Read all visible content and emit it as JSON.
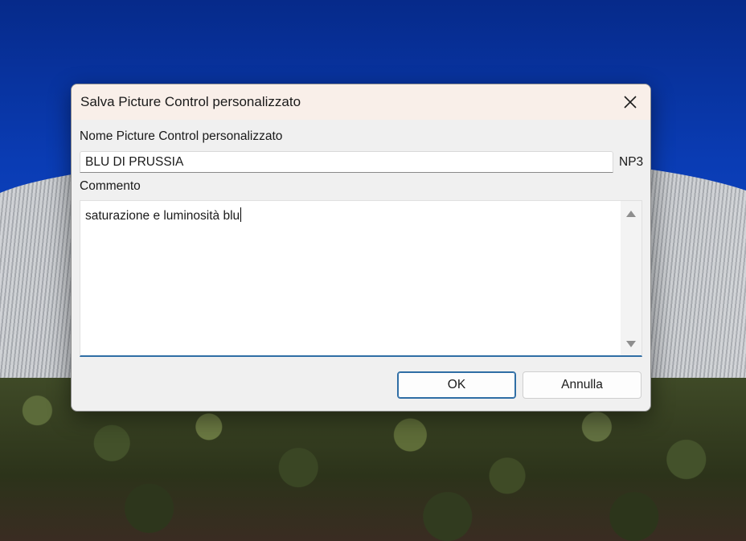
{
  "dialog": {
    "title": "Salva Picture Control personalizzato",
    "name_label": "Nome Picture Control personalizzato",
    "name_value": "BLU DI PRUSSIA",
    "extension": "NP3",
    "comment_label": "Commento",
    "comment_value": "saturazione e luminosità blu",
    "ok_label": "OK",
    "cancel_label": "Annulla"
  },
  "colors": {
    "accent": "#2f6ea5",
    "titlebar": "#f9efe9",
    "dialog_bg": "#f0f0f0"
  },
  "icons": {
    "close": "close-icon",
    "scroll_up": "scroll-up-arrow-icon",
    "scroll_down": "scroll-down-arrow-icon"
  }
}
